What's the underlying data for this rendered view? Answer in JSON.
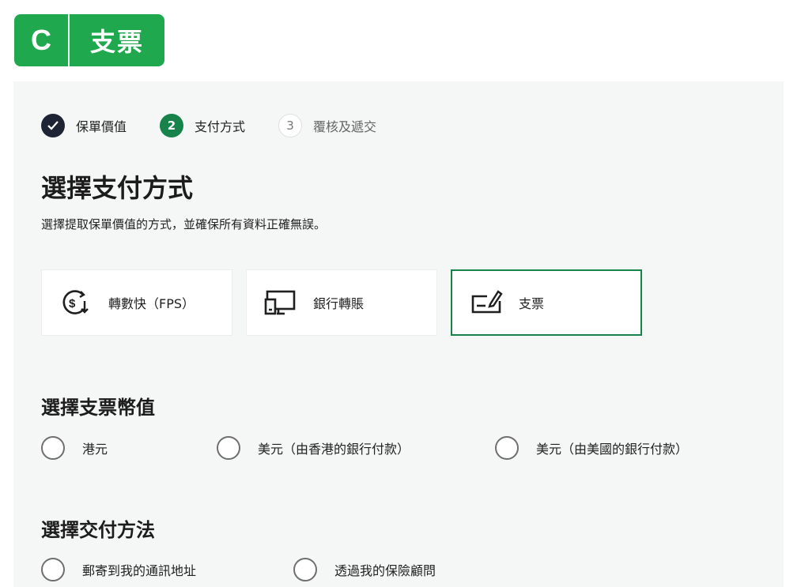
{
  "badge": {
    "letter": "C",
    "title": "支票"
  },
  "colors": {
    "brand_green": "#1fa84d",
    "accent_green": "#17834a",
    "step_done": "#1e2433",
    "panel_bg": "#f5f6f6"
  },
  "stepper": {
    "steps": [
      {
        "number": "✓",
        "label": "保單價值",
        "state": "done"
      },
      {
        "number": "2",
        "label": "支付方式",
        "state": "active"
      },
      {
        "number": "3",
        "label": "覆核及遞交",
        "state": "todo"
      }
    ]
  },
  "main": {
    "title": "選擇支付方式",
    "subtitle": "選擇提取保單價值的方式，並確保所有資料正確無誤。"
  },
  "payment_methods": [
    {
      "label": "轉數快（FPS）",
      "icon": "fps-dollar-icon",
      "selected": false
    },
    {
      "label": "銀行轉賬",
      "icon": "bank-transfer-icon",
      "selected": false
    },
    {
      "label": "支票",
      "icon": "cheque-icon",
      "selected": true
    }
  ],
  "currency": {
    "title": "選擇支票幣值",
    "options": [
      "港元",
      "美元（由香港的銀行付款）",
      "美元（由美國的銀行付款）"
    ]
  },
  "delivery": {
    "title": "選擇交付方法",
    "options": [
      "郵寄到我的通訊地址",
      "透過我的保險顧問"
    ]
  }
}
